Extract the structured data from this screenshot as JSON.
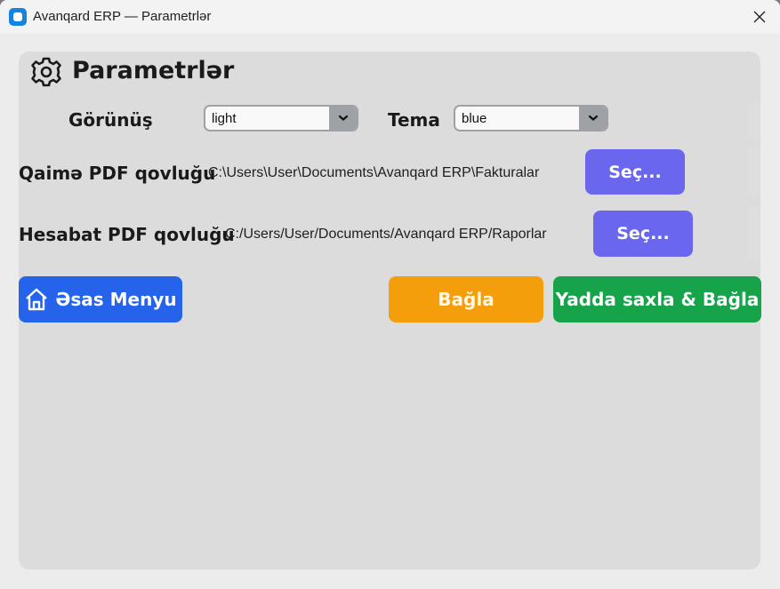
{
  "window": {
    "title": "Avanqard ERP — Parametrlər",
    "close_glyph": "✕"
  },
  "heading": {
    "title": "Parametrlər",
    "icon": "gear-icon"
  },
  "appearance": {
    "label": "Görünüş",
    "value": "light"
  },
  "theme": {
    "label": "Tema",
    "value": "blue"
  },
  "invoice_folder": {
    "label": "Qaimə PDF qovluğu",
    "path": "C:\\Users\\User\\Documents\\Avanqard ERP\\Fakturalar",
    "button": "Seç..."
  },
  "report_folder": {
    "label": "Hesabat PDF qovluğu",
    "path": "C:/Users/User/Documents/Avanqard ERP/Raporlar",
    "button": "Seç..."
  },
  "footer": {
    "home_button": "Əsas Menyu",
    "home_icon": "home-icon",
    "close_button": "Bağla",
    "save_button": "Yadda saxla & Bağla"
  },
  "colors": {
    "select_button": "#6b66ee",
    "home_button": "#2563eb",
    "close_button": "#f59e0b",
    "save_button": "#16a34a"
  }
}
